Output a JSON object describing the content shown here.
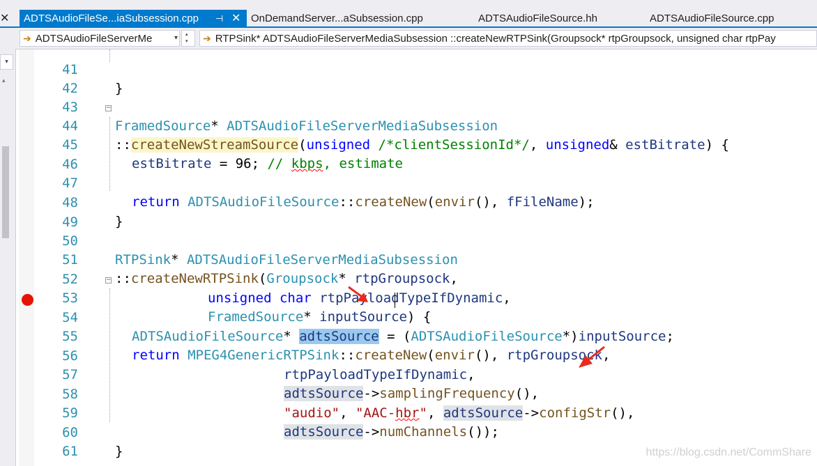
{
  "tabs": [
    {
      "label": "ADTSAudioFileSe...iaSubsession.cpp",
      "active": true
    },
    {
      "label": "OnDemandServer...aSubsession.cpp"
    },
    {
      "label": "ADTSAudioFileSource.hh"
    },
    {
      "label": "ADTSAudioFileSource.cpp"
    }
  ],
  "tab_icons": {
    "left": "close-icon",
    "pin": "pin-icon",
    "close": "close-icon"
  },
  "glyphs": {
    "close": "✕",
    "pin": "⊣",
    "drop": "▾",
    "up": "▴",
    "dn": "▾",
    "arrow": "➔"
  },
  "navbar": {
    "scope": "ADTSAudioFileServerMe",
    "member": "RTPSink* ADTSAudioFileServerMediaSubsession ::createNewRTPSink(Groupsock* rtpGroupsock, unsigned char rtpPay"
  },
  "colors": {
    "accent": "#007acc",
    "keyword": "#0000ff",
    "type": "#2b91af",
    "breakpoint": "#e51400"
  },
  "code": {
    "l41": {
      "n": "41",
      "t": "}"
    },
    "l42": {
      "n": "42"
    },
    "l43": {
      "n": "43",
      "a": "FramedSource",
      "b": "* ",
      "c": "ADTSAudioFileServerMediaSubsession"
    },
    "l44": {
      "n": "44",
      "a": "::",
      "b": "createNewStreamSource",
      "c": "(",
      "d": "unsigned",
      "e": " ",
      "f": "/*clientSessionId*/",
      "g": ", ",
      "h": "unsigned",
      "i": "& ",
      "j": "estBitrate",
      "k": ") {"
    },
    "l45": {
      "n": "45",
      "a": "estBitrate",
      "b": " = 96; ",
      "c": "// ",
      "d": "kbps",
      "e": ", estimate"
    },
    "l46": {
      "n": "46"
    },
    "l47": {
      "n": "47",
      "a": "return",
      "b": " ",
      "c": "ADTSAudioFileSource",
      "d": "::",
      "e": "createNew",
      "f": "(",
      "g": "envir",
      "h": "(), ",
      "i": "fFileName",
      "j": ");"
    },
    "l48": {
      "n": "48",
      "t": "}"
    },
    "l49": {
      "n": "49"
    },
    "l50": {
      "n": "50",
      "a": "RTPSink",
      "b": "* ",
      "c": "ADTSAudioFileServerMediaSubsession"
    },
    "l51": {
      "n": "51",
      "a": "::",
      "b": "createNewRTPSink",
      "c": "(",
      "d": "Groupsock",
      "e": "* ",
      "f": "rtpGroupsock",
      "g": ","
    },
    "l52": {
      "n": "52",
      "a": "unsigned",
      "b": " ",
      "c": "char",
      "d": " ",
      "e": "rtpPayloadTypeIfDynamic",
      "f": ","
    },
    "l53": {
      "n": "53",
      "a": "FramedSource",
      "b": "* ",
      "c": "inputSource",
      "d": ") {"
    },
    "l54": {
      "n": "54",
      "a": "ADTSAudioFileSource",
      "b": "* ",
      "c": "adtsSource",
      "d": " = (",
      "e": "ADTSAudioFileSource",
      "f": "*)",
      "g": "inputSource",
      "h": ";"
    },
    "l55": {
      "n": "55",
      "a": "return",
      "b": " ",
      "c": "MPEG4GenericRTPSink",
      "d": "::",
      "e": "createNew",
      "f": "(",
      "g": "envir",
      "h": "(), ",
      "i": "rtpGroupsock",
      "j": ","
    },
    "l56": {
      "n": "56",
      "a": "rtpPayloadTypeIfDynamic",
      "b": ","
    },
    "l57": {
      "n": "57",
      "a": "adtsSource",
      "b": "->",
      "c": "samplingFrequency",
      "d": "(),"
    },
    "l58": {
      "n": "58",
      "a": "\"audio\"",
      "b": ", ",
      "c": "\"AAC-",
      "d": "hbr",
      "e": "\"",
      "f": ", ",
      "g": "adtsSource",
      "h": "->",
      "i": "configStr",
      "j": "(),"
    },
    "l59": {
      "n": "59",
      "a": "adtsSource",
      "b": "->",
      "c": "numChannels",
      "d": "());"
    },
    "l60": {
      "n": "60",
      "t": "}"
    },
    "l61": {
      "n": "61"
    }
  },
  "watermark": "https://blog.csdn.net/CommShare"
}
